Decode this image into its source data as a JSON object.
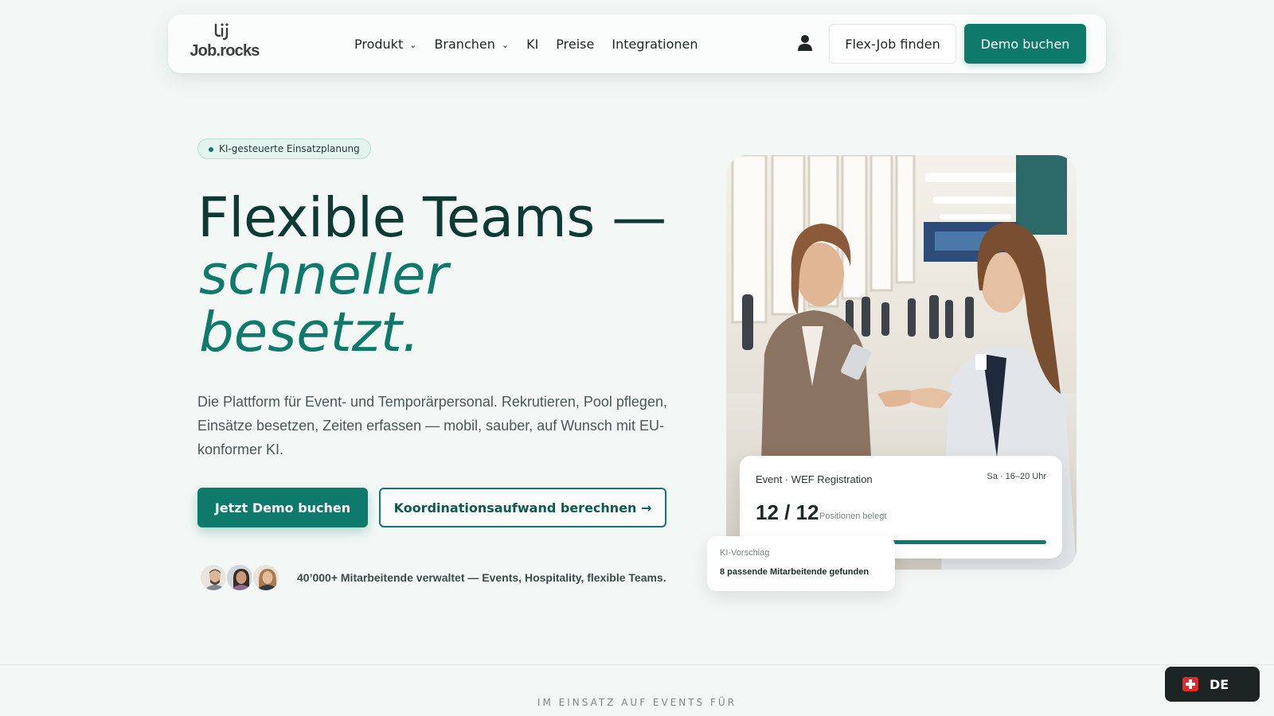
{
  "nav": {
    "logo_text": "Job.rocks",
    "links": [
      {
        "label": "Produkt",
        "dropdown": true
      },
      {
        "label": "Branchen",
        "dropdown": true
      },
      {
        "label": "KI",
        "dropdown": false
      },
      {
        "label": "Preise",
        "dropdown": false
      },
      {
        "label": "Integrationen",
        "dropdown": false
      }
    ],
    "chevron": "⌄",
    "account_icon": "user-icon",
    "flex_job_label": "Flex-Job finden",
    "demo_label": "Demo buchen"
  },
  "hero": {
    "badge": "KI-gesteuerte Einsatzplanung",
    "title_line1": "Flexible Teams —",
    "title_line2": "schneller",
    "title_line3": "besetzt.",
    "lead": "Die Plattform für Event- und Temporärpersonal. Rekrutieren, Pool pflegen, Einsätze besetzen, Zeiten erfassen — mobil, sauber, auf Wunsch mit EU-konformer KI.",
    "cta_primary": "Jetzt Demo buchen",
    "cta_secondary": "Koordinationsaufwand berechnen →",
    "social_proof": "40’000+ Mitarbeitende verwaltet — Events, Hospitality, flexible Teams."
  },
  "event_card": {
    "label": "Event · WEF Registration",
    "time": "Sa · 16–20 Uhr",
    "count": "12 / 12",
    "count_sub": "Positionen belegt",
    "progress": 1.0
  },
  "ai_card": {
    "label": "KI-Vorschlag",
    "text": "8 passende Mitarbeitende gefunden"
  },
  "footer": {
    "clients_heading": "IM EINSATZ AUF EVENTS FÜR",
    "language": "DE"
  },
  "colors": {
    "brand": "#0e7a6c",
    "heading": "#0e3a34",
    "background": "#f3f8f6"
  }
}
